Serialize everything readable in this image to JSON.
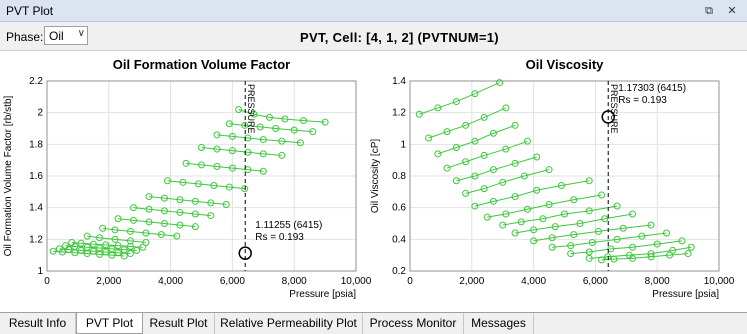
{
  "window": {
    "title": "PVT Plot",
    "restore_icon": "restore-icon",
    "close_icon": "close-icon"
  },
  "toolbar": {
    "phase_label": "Phase:",
    "phase_value": "Oil",
    "cell_title": "PVT, Cell: [4, 1, 2] (PVTNUM=1)"
  },
  "tabs": [
    {
      "label": "Result Info",
      "active": false
    },
    {
      "label": "PVT Plot",
      "active": true
    },
    {
      "label": "Result Plot",
      "active": false
    },
    {
      "label": "Relative Permeability Plot",
      "active": false
    },
    {
      "label": "Process Monitor",
      "active": false
    },
    {
      "label": "Messages",
      "active": false
    }
  ],
  "chart_data": [
    {
      "type": "line",
      "title": "Oil  Formation Volume Factor",
      "xlabel": "Pressure [psia]",
      "ylabel": "Oil Formation Volume Factor [rb/stb]",
      "xlim": [
        0,
        10000
      ],
      "ylim": [
        1,
        2.2
      ],
      "xticks": [
        "0",
        "2,000",
        "4,000",
        "6,000",
        "8,000",
        "10,000"
      ],
      "yticks": [
        "1",
        "1.2",
        "1.4",
        "1.6",
        "1.8",
        "2",
        "2.2"
      ],
      "color": "#3cc83c",
      "series": [
        {
          "x": [
            200,
            500,
            900,
            1300,
            1700,
            2100,
            2500
          ],
          "y": [
            1.125,
            1.12,
            1.115,
            1.11,
            1.105,
            1.1,
            1.095
          ]
        },
        {
          "x": [
            400,
            700,
            1100,
            1500,
            1900,
            2300,
            2700
          ],
          "y": [
            1.14,
            1.135,
            1.13,
            1.125,
            1.12,
            1.115,
            1.11
          ]
        },
        {
          "x": [
            600,
            900,
            1300,
            1700,
            2100,
            2500,
            2900
          ],
          "y": [
            1.16,
            1.155,
            1.15,
            1.145,
            1.14,
            1.135,
            1.13
          ]
        },
        {
          "x": [
            800,
            1100,
            1500,
            1900,
            2300,
            2700,
            3100
          ],
          "y": [
            1.18,
            1.175,
            1.17,
            1.165,
            1.16,
            1.155,
            1.15
          ]
        },
        {
          "x": [
            1300,
            1700,
            2200,
            2700,
            3200
          ],
          "y": [
            1.22,
            1.21,
            1.2,
            1.19,
            1.18
          ]
        },
        {
          "x": [
            1800,
            2200,
            2700,
            3200,
            3700,
            4200
          ],
          "y": [
            1.27,
            1.26,
            1.25,
            1.24,
            1.23,
            1.22
          ]
        },
        {
          "x": [
            2300,
            2800,
            3300,
            3800,
            4300,
            4800
          ],
          "y": [
            1.33,
            1.32,
            1.31,
            1.3,
            1.29,
            1.28
          ]
        },
        {
          "x": [
            2800,
            3300,
            3800,
            4300,
            4800,
            5300
          ],
          "y": [
            1.4,
            1.39,
            1.38,
            1.37,
            1.36,
            1.35
          ]
        },
        {
          "x": [
            3300,
            3800,
            4300,
            4800,
            5300,
            5800
          ],
          "y": [
            1.47,
            1.46,
            1.45,
            1.44,
            1.43,
            1.42
          ]
        },
        {
          "x": [
            3900,
            4400,
            4900,
            5400,
            5900,
            6400
          ],
          "y": [
            1.57,
            1.56,
            1.55,
            1.54,
            1.53,
            1.52
          ]
        },
        {
          "x": [
            4500,
            5000,
            5500,
            6000,
            6500,
            7000
          ],
          "y": [
            1.68,
            1.67,
            1.66,
            1.65,
            1.64,
            1.63
          ]
        },
        {
          "x": [
            5000,
            5500,
            6000,
            6500,
            7000,
            7600
          ],
          "y": [
            1.78,
            1.77,
            1.76,
            1.75,
            1.74,
            1.73
          ]
        },
        {
          "x": [
            5500,
            6000,
            6500,
            7000,
            7600,
            8200
          ],
          "y": [
            1.86,
            1.85,
            1.84,
            1.83,
            1.82,
            1.81
          ]
        },
        {
          "x": [
            5900,
            6400,
            6900,
            7400,
            8000,
            8600
          ],
          "y": [
            1.93,
            1.92,
            1.91,
            1.9,
            1.89,
            1.88
          ]
        },
        {
          "x": [
            6200,
            6700,
            7200,
            7700,
            8300,
            9000
          ],
          "y": [
            2.02,
            1.99,
            1.97,
            1.96,
            1.95,
            1.94
          ]
        }
      ],
      "annotation": {
        "x": 6415,
        "y": 1.11255,
        "line1": "1.11255 (6415)",
        "line2": "Rs = 0.193",
        "vline_label": "PRESSURE"
      }
    },
    {
      "type": "line",
      "title": "Oil  Viscosity",
      "xlabel": "Pressure [psia]",
      "ylabel": "Oil Viscosity [cP]",
      "xlim": [
        0,
        10000
      ],
      "ylim": [
        0.2,
        1.4
      ],
      "xticks": [
        "0",
        "2,000",
        "4,000",
        "6,000",
        "8,000",
        "10,000"
      ],
      "yticks": [
        "0.2",
        "0.4",
        "0.6",
        "0.8",
        "1",
        "1.2",
        "1.4"
      ],
      "color": "#3cc83c",
      "series": [
        {
          "x": [
            300,
            900,
            1500,
            2100,
            2900
          ],
          "y": [
            1.19,
            1.23,
            1.27,
            1.32,
            1.39
          ]
        },
        {
          "x": [
            600,
            1200,
            1800,
            2400,
            3100
          ],
          "y": [
            1.04,
            1.08,
            1.12,
            1.17,
            1.23
          ]
        },
        {
          "x": [
            900,
            1500,
            2100,
            2700,
            3400
          ],
          "y": [
            0.94,
            0.98,
            1.02,
            1.07,
            1.12
          ]
        },
        {
          "x": [
            1200,
            1800,
            2400,
            3100,
            3800
          ],
          "y": [
            0.85,
            0.89,
            0.93,
            0.97,
            1.02
          ]
        },
        {
          "x": [
            1500,
            2100,
            2700,
            3400,
            4100
          ],
          "y": [
            0.77,
            0.8,
            0.84,
            0.88,
            0.92
          ]
        },
        {
          "x": [
            1800,
            2400,
            3000,
            3700,
            4500
          ],
          "y": [
            0.69,
            0.72,
            0.76,
            0.8,
            0.84
          ]
        },
        {
          "x": [
            2100,
            2700,
            3400,
            4100,
            4900,
            5800
          ],
          "y": [
            0.61,
            0.64,
            0.67,
            0.71,
            0.74,
            0.77
          ]
        },
        {
          "x": [
            2500,
            3100,
            3800,
            4500,
            5300,
            6200
          ],
          "y": [
            0.54,
            0.56,
            0.59,
            0.62,
            0.65,
            0.68
          ]
        },
        {
          "x": [
            3000,
            3600,
            4300,
            5000,
            5800,
            6700
          ],
          "y": [
            0.49,
            0.51,
            0.53,
            0.56,
            0.58,
            0.61
          ]
        },
        {
          "x": [
            3400,
            4000,
            4700,
            5500,
            6300,
            7200
          ],
          "y": [
            0.44,
            0.46,
            0.48,
            0.5,
            0.53,
            0.56
          ]
        },
        {
          "x": [
            4000,
            4600,
            5300,
            6100,
            6900,
            7800
          ],
          "y": [
            0.39,
            0.41,
            0.43,
            0.45,
            0.47,
            0.49
          ]
        },
        {
          "x": [
            4600,
            5200,
            5900,
            6700,
            7500,
            8300
          ],
          "y": [
            0.35,
            0.36,
            0.38,
            0.4,
            0.42,
            0.44
          ]
        },
        {
          "x": [
            5200,
            5800,
            6500,
            7200,
            8000,
            8800
          ],
          "y": [
            0.31,
            0.32,
            0.34,
            0.35,
            0.37,
            0.39
          ]
        },
        {
          "x": [
            5800,
            6400,
            7100,
            7800,
            8500,
            9100
          ],
          "y": [
            0.28,
            0.29,
            0.3,
            0.31,
            0.33,
            0.35
          ]
        },
        {
          "x": [
            6200,
            6600,
            7200,
            7800,
            8400,
            9000
          ],
          "y": [
            0.27,
            0.275,
            0.28,
            0.29,
            0.3,
            0.31
          ]
        }
      ],
      "annotation": {
        "x": 6415,
        "y": 1.17303,
        "line1": "1.17303 (6415)",
        "line2": "Rs = 0.193",
        "vline_label": "PRESSURE"
      }
    }
  ]
}
